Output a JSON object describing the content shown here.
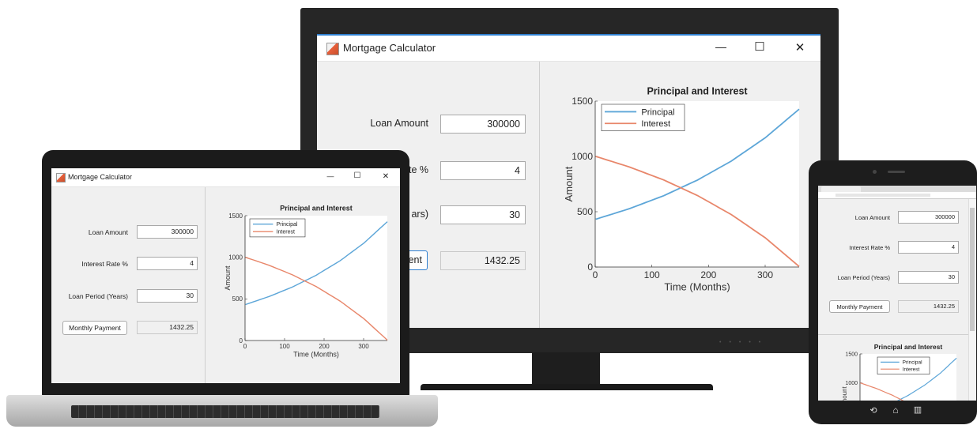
{
  "app": {
    "title": "Mortgage Calculator"
  },
  "controls": {
    "minimize": "—",
    "maximize": "☐",
    "close": "✕"
  },
  "form": {
    "loan_amount_label": "Loan Amount",
    "loan_amount_value": "300000",
    "interest_rate_label": "Interest Rate %",
    "interest_rate_value": "4",
    "loan_period_label": "Loan Period (Years)",
    "loan_period_value": "30",
    "monthly_payment_button": "Monthly Payment",
    "monthly_payment_value": "1432.25"
  },
  "monitor_partial": {
    "interest_rate_label": "te %",
    "loan_period_label": "ars)",
    "monthly_payment_button": "ent"
  },
  "phone": {
    "nav_back": "⟲",
    "nav_home": "⌂",
    "nav_recent": "▥"
  },
  "colors": {
    "principal": "#5da6d8",
    "interest": "#e8866a",
    "accent": "#2f7fd0"
  },
  "chart_data": {
    "type": "line",
    "title": "Principal and Interest",
    "xlabel": "Time (Months)",
    "ylabel": "Amount",
    "xlim": [
      0,
      360
    ],
    "ylim": [
      0,
      1500
    ],
    "xticks": [
      0,
      100,
      200,
      300
    ],
    "yticks": [
      0,
      500,
      1000,
      1500
    ],
    "legend": "top-left",
    "series": [
      {
        "name": "Principal",
        "x": [
          1,
          60,
          120,
          180,
          240,
          300,
          360
        ],
        "y": [
          432.25,
          527,
          643,
          785,
          957,
          1168,
          1427.5
        ]
      },
      {
        "name": "Interest",
        "x": [
          1,
          60,
          120,
          180,
          240,
          300,
          360
        ],
        "y": [
          1000,
          905.3,
          789.3,
          647.9,
          475.3,
          264.7,
          4.75
        ]
      }
    ]
  }
}
